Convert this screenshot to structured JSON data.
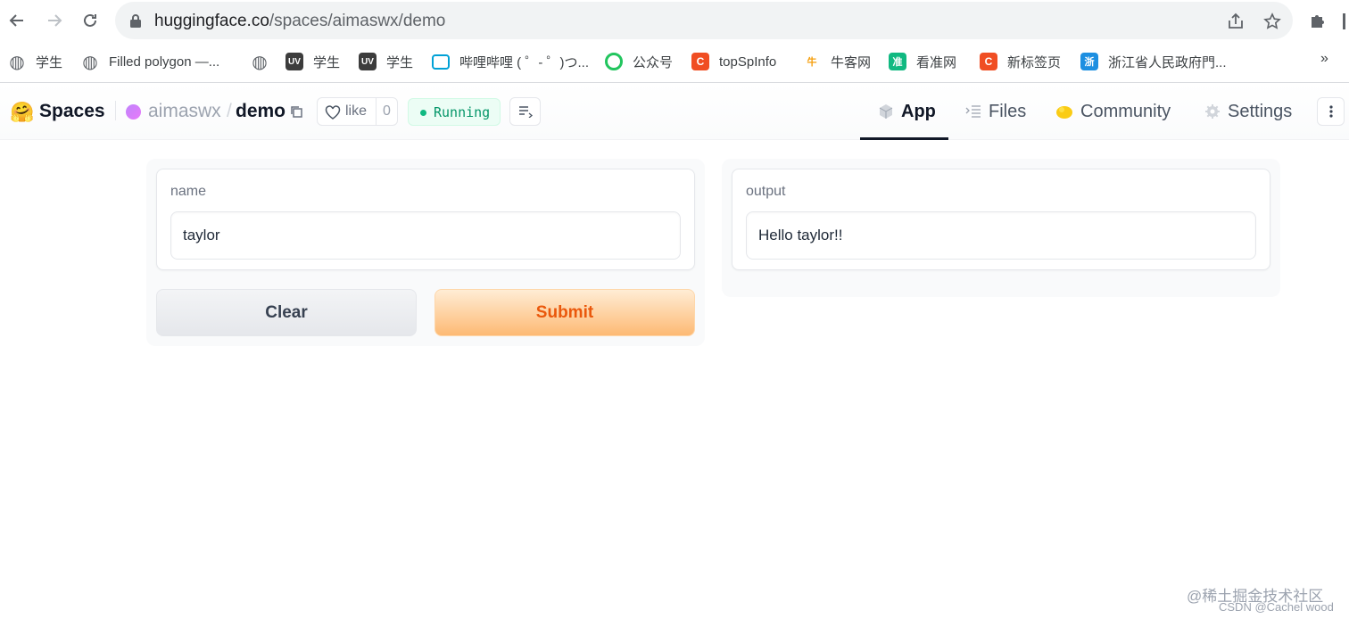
{
  "browser": {
    "url_host": "huggingface.co",
    "url_path": "/spaces/aimaswx/demo"
  },
  "bookmarks": [
    {
      "label": "学生",
      "icon": "globe-icon"
    },
    {
      "label": "Filled polygon —...",
      "icon": "globe-icon"
    },
    {
      "label": "",
      "icon": "globe-icon"
    },
    {
      "label": "学生",
      "icon": "uv-icon"
    },
    {
      "label": "学生",
      "icon": "uv-icon"
    },
    {
      "label": "哔哩哔哩 ( ゜- ゜)つ...",
      "icon": "bilibili-icon"
    },
    {
      "label": "公众号",
      "icon": "wechat-icon"
    },
    {
      "label": "topSpInfo",
      "icon": "csdn-icon"
    },
    {
      "label": "牛客网",
      "icon": "nowcoder-icon"
    },
    {
      "label": "看准网",
      "icon": "kanzhun-icon"
    },
    {
      "label": "新标签页",
      "icon": "csdn-icon"
    },
    {
      "label": "浙江省人民政府門...",
      "icon": "zj-gov-icon"
    }
  ],
  "bookmarks_more": "»",
  "hf": {
    "logo": "🤗",
    "spaces": "Spaces",
    "owner": "aimaswx",
    "slash": "/",
    "repo": "demo",
    "like_label": "like",
    "like_count": "0",
    "status": "Running",
    "tabs": {
      "app": "App",
      "files": "Files",
      "community": "Community",
      "settings": "Settings"
    }
  },
  "app": {
    "input_label": "name",
    "input_value": "taylor",
    "output_label": "output",
    "output_value": "Hello taylor!!",
    "clear_label": "Clear",
    "submit_label": "Submit"
  },
  "watermark": {
    "line1": "@稀土掘金技术社区",
    "line2": "CSDN @Cachel wood"
  },
  "colors": {
    "accent_orange": "#ea580c",
    "running_green": "#10b981"
  }
}
